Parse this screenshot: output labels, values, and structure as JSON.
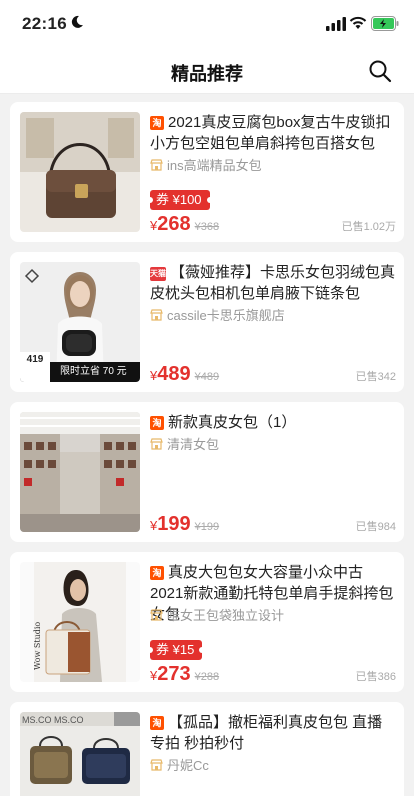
{
  "status_bar": {
    "time": "22:16"
  },
  "nav": {
    "title": "精品推荐"
  },
  "products": [
    {
      "platform_label": "淘",
      "title": "2021真皮豆腐包box复古牛皮锁扣小方包空姐包单肩斜挎包百搭女包",
      "shop": "ins高端精品女包",
      "coupon": "券 ¥100",
      "currency": "¥",
      "price": "268",
      "orig_price": "¥368",
      "sold": "已售1.02万"
    },
    {
      "platform_label": "天猫",
      "title": "【薇娅推荐】卡思乐女包羽绒包真皮枕头包相机包单肩腋下链条包",
      "shop": "cassile卡思乐旗舰店",
      "currency": "¥",
      "price": "489",
      "orig_price": "¥489",
      "sold": "已售342",
      "thumb_badge_price": "419",
      "thumb_badge_text": "限时立省 70 元"
    },
    {
      "platform_label": "淘",
      "title": "新款真皮女包（1）",
      "shop": "清清女包",
      "currency": "¥",
      "price": "199",
      "orig_price": "¥199",
      "sold": "已售984"
    },
    {
      "platform_label": "淘",
      "title": "真皮大包包女大容量小众中古2021新款通勤托特包单肩手提斜挎包女包",
      "shop": "唯女王包袋独立设计",
      "coupon": "券 ¥15",
      "currency": "¥",
      "price": "273",
      "orig_price": "¥288",
      "sold": "已售386"
    },
    {
      "platform_label": "淘",
      "title": "【孤品】撤柜福利真皮包包 直播专拍 秒拍秒付",
      "shop": "丹妮Cc"
    }
  ],
  "colors": {
    "accent": "#e3312d",
    "platform": "#ff5000"
  }
}
